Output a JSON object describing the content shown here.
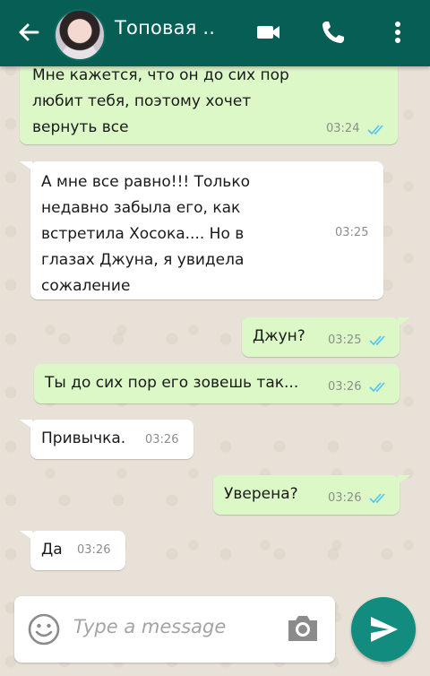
{
  "header": {
    "title": "Топовая ..",
    "bg_color": "#075e54"
  },
  "messages": [
    {
      "direction": "out",
      "text": "Мне кажется, что он до сих пор\nлюбит тебя, поэтому хочет\nвернуть все",
      "time": "03:24",
      "status": "read"
    },
    {
      "direction": "in",
      "text": "А мне все равно!!! Только\nнедавно забыла его, как\nвстретила Хосока.... Но в\nглазах Джуна, я увидела\nсожаление",
      "time": "03:25"
    },
    {
      "direction": "out",
      "text": "Джун?",
      "time": "03:25",
      "status": "read"
    },
    {
      "direction": "out",
      "text": "Ты до сих пор его зовешь так...",
      "time": "03:26",
      "status": "read"
    },
    {
      "direction": "in",
      "text": "Привычка.",
      "time": "03:26"
    },
    {
      "direction": "out",
      "text": "Уверена?",
      "time": "03:26",
      "status": "read"
    },
    {
      "direction": "in",
      "text": "Да",
      "time": "03:26"
    }
  ],
  "composer": {
    "placeholder": "Type a message"
  },
  "icons": {
    "back": "arrow-left-icon",
    "video": "video-camera-icon",
    "call": "phone-icon",
    "menu": "more-vertical-icon",
    "emoji": "emoji-icon",
    "camera": "camera-icon",
    "send": "send-icon"
  },
  "colors": {
    "outgoing_bubble": "#dcf8c6",
    "incoming_bubble": "#ffffff",
    "read_ticks": "#4fc3f7",
    "send_button": "#128c7e"
  }
}
